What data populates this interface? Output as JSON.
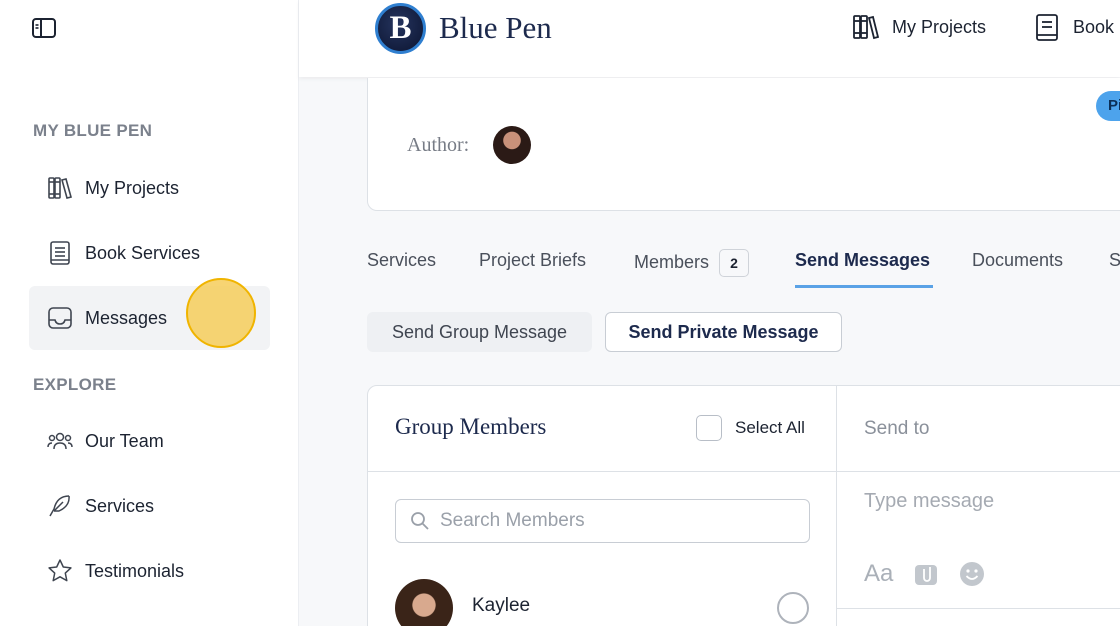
{
  "sidebar": {
    "sections": [
      {
        "title": "MY BLUE PEN"
      },
      {
        "title": "EXPLORE"
      }
    ],
    "items": [
      {
        "label": "My Projects",
        "icon": "books-icon"
      },
      {
        "label": "Book Services",
        "icon": "document-icon"
      },
      {
        "label": "Messages",
        "icon": "inbox-icon",
        "active": true
      },
      {
        "label": "Our Team",
        "icon": "team-icon"
      },
      {
        "label": "Services",
        "icon": "feather-icon"
      },
      {
        "label": "Testimonials",
        "icon": "star-icon"
      }
    ]
  },
  "header": {
    "logo_letter": "B",
    "logo_text": "Blue Pen",
    "links": [
      {
        "label": "My Projects",
        "icon": "books-icon"
      },
      {
        "label": "Book",
        "icon": "document-icon"
      }
    ]
  },
  "project": {
    "author_label": "Author:",
    "pill_text": "Pi"
  },
  "tabs": [
    {
      "label": "Services"
    },
    {
      "label": "Project Briefs"
    },
    {
      "label": "Members",
      "count": "2"
    },
    {
      "label": "Send Messages",
      "active": true
    },
    {
      "label": "Documents"
    },
    {
      "label": "S"
    }
  ],
  "message_type_buttons": {
    "group": "Send Group Message",
    "private": "Send Private Message"
  },
  "members_panel": {
    "title": "Group Members",
    "select_all": "Select All",
    "search_placeholder": "Search Members",
    "members": [
      {
        "name": "Kaylee"
      }
    ]
  },
  "composer": {
    "send_to": "Send to",
    "message_placeholder": "Type message",
    "format_label": "Aa"
  },
  "colors": {
    "accent": "#5aa2e6",
    "brand_navy": "#1d2a4d",
    "click_marker": "#f6cd5a"
  }
}
